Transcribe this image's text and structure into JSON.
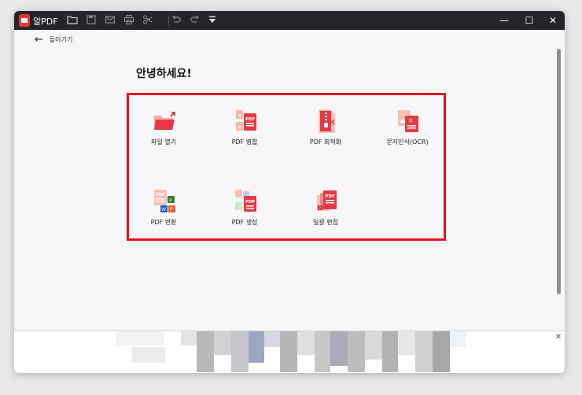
{
  "app": {
    "name": "알PDF"
  },
  "toolbar": {
    "icons": [
      "folder-icon",
      "save-icon",
      "mail-icon",
      "print-icon",
      "scissors-icon",
      "undo-icon",
      "redo-icon",
      "dropdown-menu-icon"
    ]
  },
  "window_controls": {
    "minimize": "—",
    "maximize": "☐",
    "close": "✕"
  },
  "nav": {
    "back_label": "돌아가기",
    "back_glyph": "←"
  },
  "main": {
    "greeting": "안녕하세요!",
    "tools": [
      {
        "label": "파일 열기",
        "icon": "folder-open-icon"
      },
      {
        "label": "PDF 병합",
        "icon": "pdf-merge-icon"
      },
      {
        "label": "PDF 최적화",
        "icon": "pdf-compress-icon"
      },
      {
        "label": "문자인식(OCR)",
        "icon": "ocr-icon"
      },
      {
        "label": "PDF 변환",
        "icon": "pdf-convert-icon"
      },
      {
        "label": "PDF 생성",
        "icon": "pdf-create-icon"
      },
      {
        "label": "일괄 편집",
        "icon": "batch-edit-icon"
      }
    ]
  },
  "ad": {
    "close_glyph": "✕"
  },
  "colors": {
    "highlight": "#e8101a",
    "accent": "#e53945",
    "titlebar": "#24262b"
  }
}
